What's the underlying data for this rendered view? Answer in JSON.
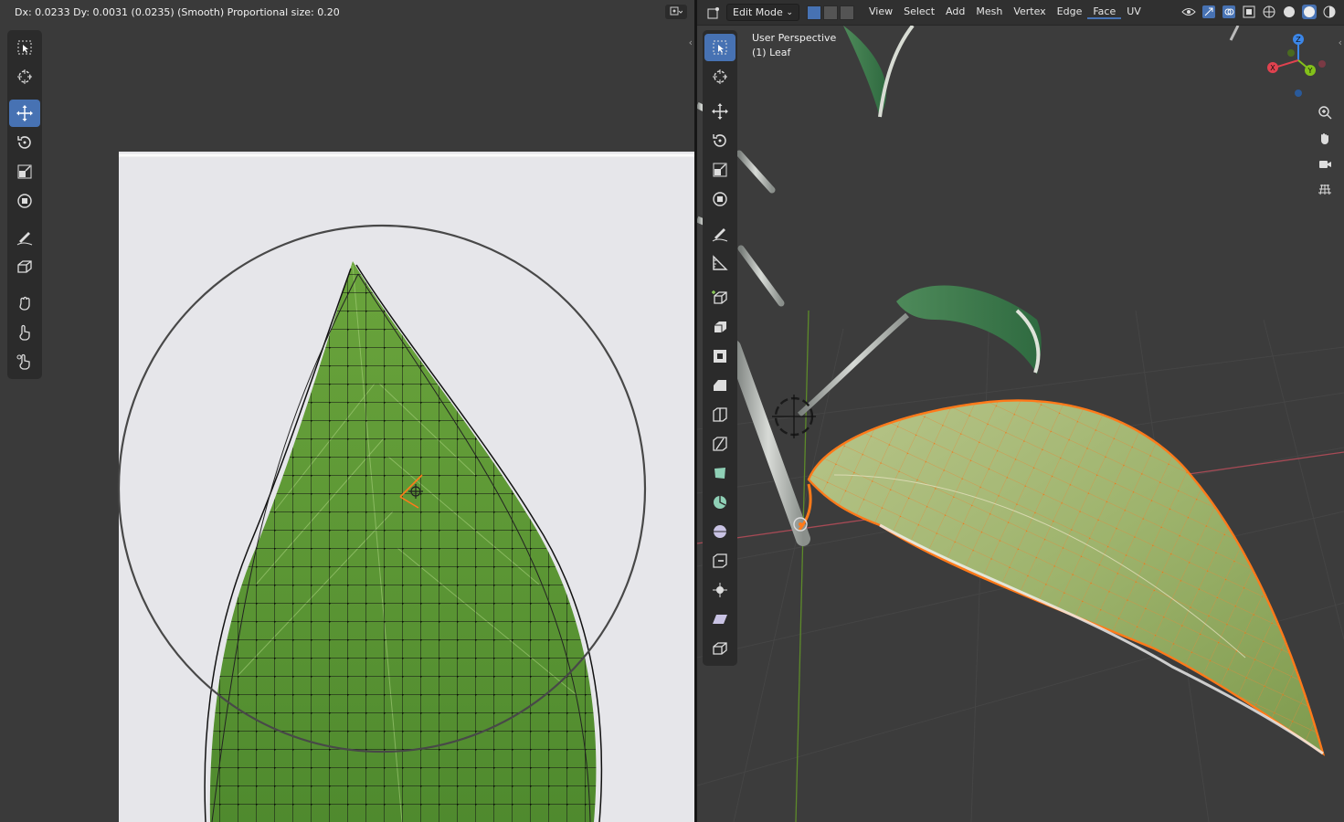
{
  "uv_editor": {
    "header_status": "Dx: 0.0233  Dy: 0.0031 (0.0235) (Smooth) Proportional size: 0.20",
    "tools": [
      {
        "name": "select-box",
        "active": false
      },
      {
        "name": "cursor",
        "active": false
      },
      {
        "name": "move",
        "active": true
      },
      {
        "name": "rotate",
        "active": false
      },
      {
        "name": "scale",
        "active": false
      },
      {
        "name": "transform",
        "active": false
      },
      {
        "name": "annotate",
        "active": false
      },
      {
        "name": "rip-region",
        "active": false
      },
      {
        "name": "grab",
        "active": false
      },
      {
        "name": "relax",
        "active": false
      },
      {
        "name": "pinch",
        "active": false
      }
    ]
  },
  "viewport": {
    "mode": "Edit Mode",
    "menu": [
      "View",
      "Select",
      "Add",
      "Mesh",
      "Vertex",
      "Edge",
      "Face",
      "UV"
    ],
    "active_menu": "Face",
    "view_label": "User Perspective",
    "object_label": "(1) Leaf",
    "gizmo_axes": [
      "X",
      "Y",
      "Z"
    ],
    "colors": {
      "accent": "#4772b3",
      "selection": "#ff7a1a",
      "axis_x": "#e0424f",
      "axis_y": "#83c11a",
      "axis_z": "#3b86e8"
    }
  }
}
